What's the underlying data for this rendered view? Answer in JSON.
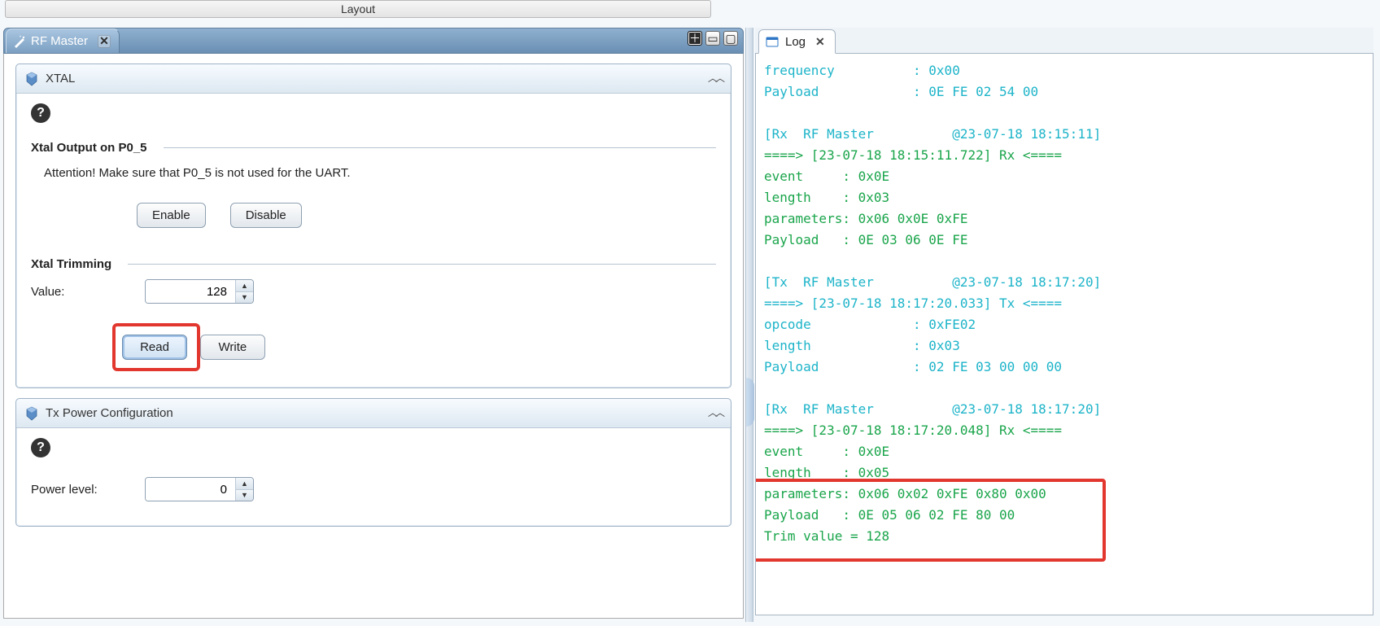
{
  "topbar": {
    "layout_label": "Layout"
  },
  "rf_tab": {
    "title": "RF Master"
  },
  "xtal": {
    "title": "XTAL",
    "output_head": "Xtal Output on P0_5",
    "attention": "Attention! Make sure that P0_5 is not used for the UART.",
    "enable_label": "Enable",
    "disable_label": "Disable",
    "trim_head": "Xtal Trimming",
    "value_label": "Value:",
    "value_value": "128",
    "read_label": "Read",
    "write_label": "Write"
  },
  "txpower": {
    "title": "Tx Power Configuration",
    "power_label": "Power level:",
    "power_value": "0"
  },
  "log_tab": {
    "title": "Log"
  },
  "log_lines": [
    {
      "cls": "cyan",
      "text": "frequency          : 0x00"
    },
    {
      "cls": "cyan",
      "text": "Payload            : 0E FE 02 54 00"
    },
    {
      "cls": "cyan",
      "text": ""
    },
    {
      "cls": "cyan",
      "text": "[Rx  RF Master          @23-07-18 18:15:11]"
    },
    {
      "cls": "green",
      "text": "====> [23-07-18 18:15:11.722] Rx <===="
    },
    {
      "cls": "green",
      "text": "event     : 0x0E"
    },
    {
      "cls": "green",
      "text": "length    : 0x03"
    },
    {
      "cls": "green",
      "text": "parameters: 0x06 0x0E 0xFE"
    },
    {
      "cls": "green",
      "text": "Payload   : 0E 03 06 0E FE"
    },
    {
      "cls": "green",
      "text": ""
    },
    {
      "cls": "cyan",
      "text": "[Tx  RF Master          @23-07-18 18:17:20]"
    },
    {
      "cls": "cyan",
      "text": "====> [23-07-18 18:17:20.033] Tx <===="
    },
    {
      "cls": "cyan",
      "text": "opcode             : 0xFE02"
    },
    {
      "cls": "cyan",
      "text": "length             : 0x03"
    },
    {
      "cls": "cyan",
      "text": "Payload            : 02 FE 03 00 00 00"
    },
    {
      "cls": "cyan",
      "text": ""
    },
    {
      "cls": "cyan",
      "text": "[Rx  RF Master          @23-07-18 18:17:20]"
    },
    {
      "cls": "green",
      "text": "====> [23-07-18 18:17:20.048] Rx <===="
    },
    {
      "cls": "green",
      "text": "event     : 0x0E"
    },
    {
      "cls": "green",
      "text": "length    : 0x05"
    },
    {
      "cls": "green",
      "text": "parameters: 0x06 0x02 0xFE 0x80 0x00"
    },
    {
      "cls": "green",
      "text": "Payload   : 0E 05 06 02 FE 80 00"
    },
    {
      "cls": "green",
      "text": "Trim value = 128"
    }
  ]
}
